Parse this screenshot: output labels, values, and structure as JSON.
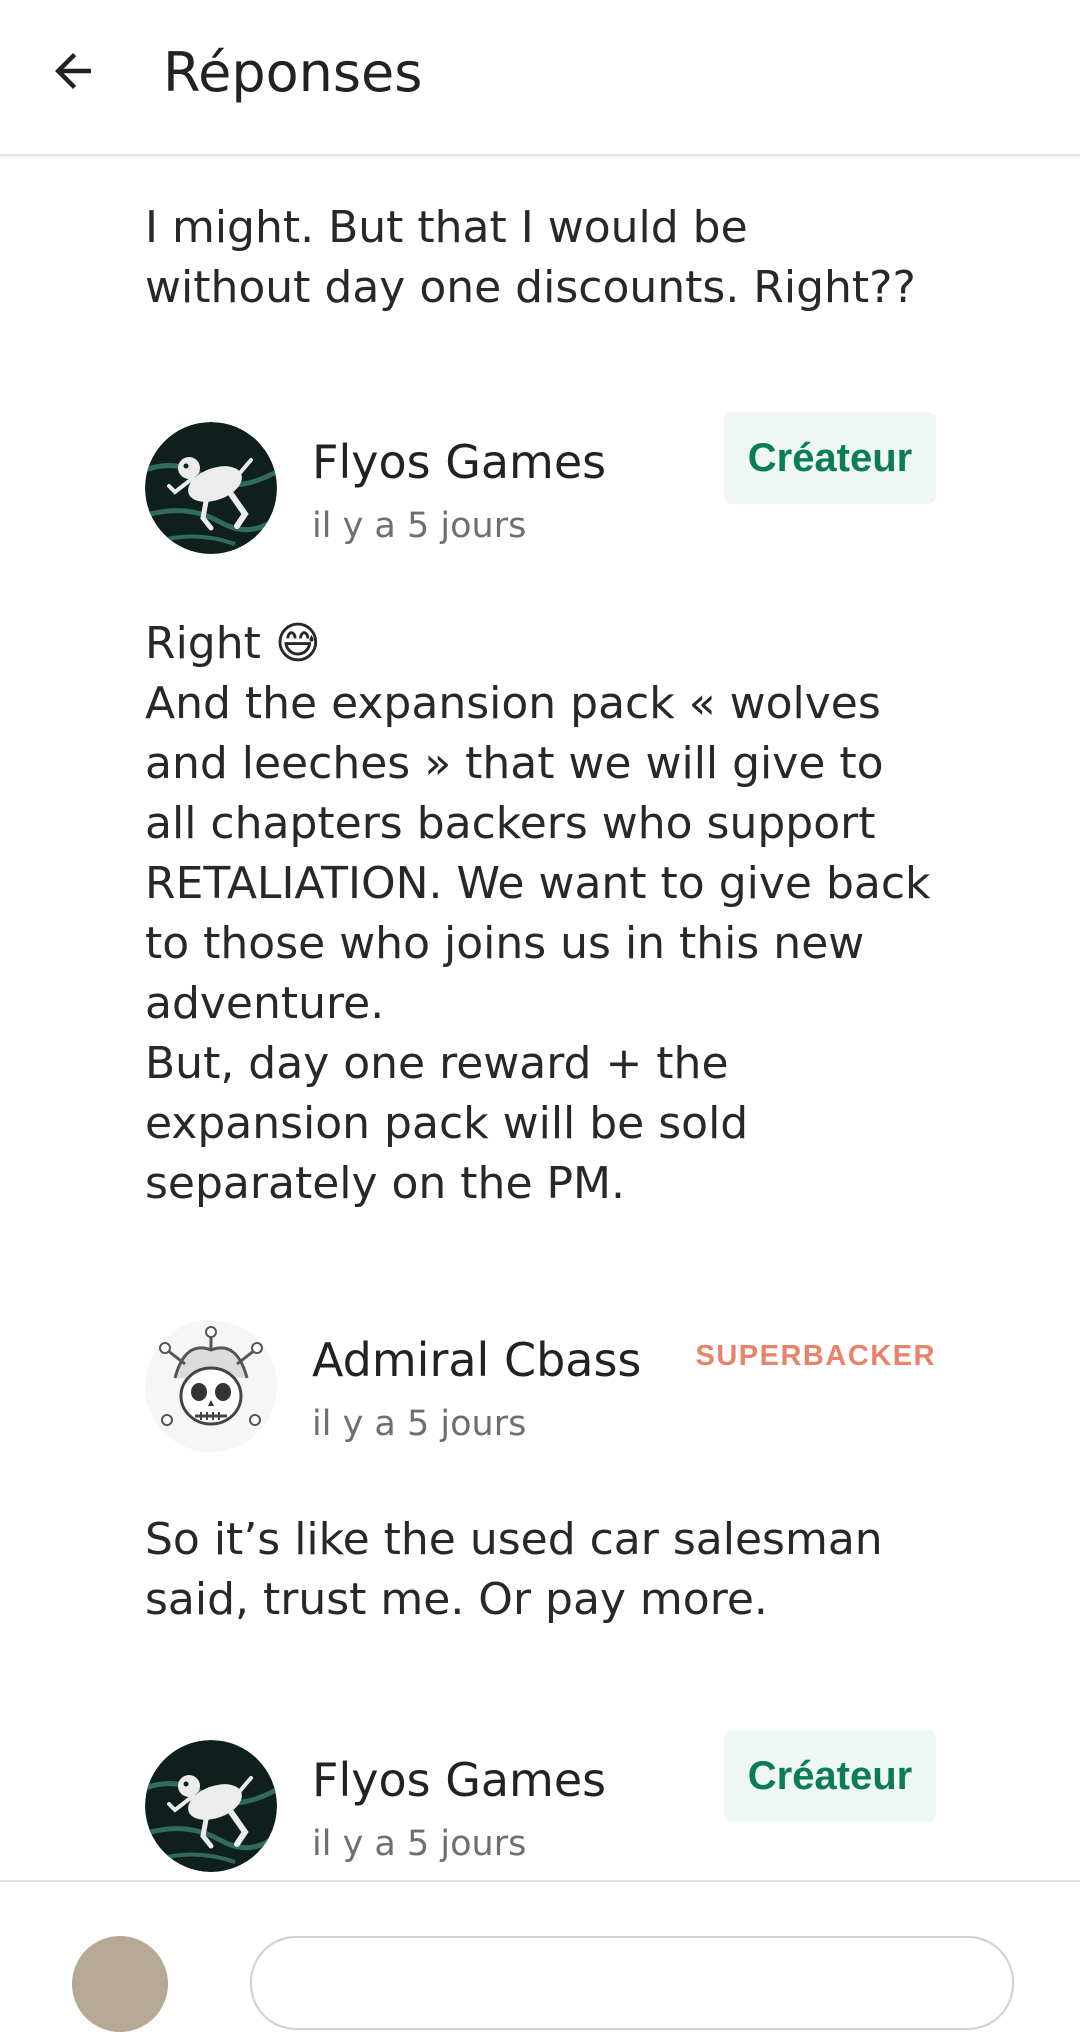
{
  "appbar": {
    "title": "Réponses",
    "back_icon": "arrow-left-icon"
  },
  "comments": [
    {
      "body": "I might.  But that I would be\nwithout day one discounts.   Right??"
    },
    {
      "author": "Flyos Games",
      "time": "il y a 5 jours",
      "badge": "Créateur",
      "avatar_icon": "frog-avatar-icon",
      "emoji": "😅",
      "body_first": "Right ",
      "body_rest": "And the expansion pack « wolves\nand leeches » that we will give to\nall chapters backers who support\nRETALIATION. We want to give back\nto those who joins us in this new\nadventure.\nBut, day one reward + the\nexpansion pack will be sold\nseparately on the PM."
    },
    {
      "author": "Admiral Cbass",
      "time": "il y a 5 jours",
      "badge": "SUPERBACKER",
      "avatar_icon": "jester-skull-avatar-icon",
      "body": "So it’s like the used car salesman\nsaid, trust me.    Or pay more."
    },
    {
      "author": "Flyos Games",
      "time": "il y a 5 jours",
      "badge": "Créateur",
      "avatar_icon": "frog-avatar-icon"
    }
  ],
  "colors": {
    "creator_badge_text": "#0b7d55",
    "creator_badge_bg": "#eef7f3",
    "superbacker_text": "#e8826a",
    "timestamp_text": "#6f6f6f"
  }
}
